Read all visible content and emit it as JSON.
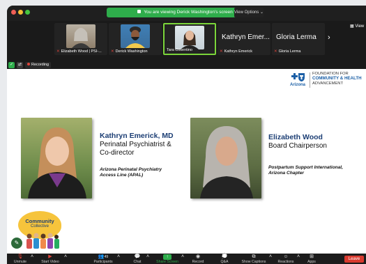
{
  "banner": {
    "text": "You are viewing Derick Washington's screen",
    "view_options": "View Options ⌄"
  },
  "thumbnails": [
    {
      "name": "Elizabeth Wood | PSI-...",
      "has_video": true,
      "active": false
    },
    {
      "name": "Derick Washington",
      "has_video": true,
      "active": false
    },
    {
      "name": "Tara Cosentino",
      "has_video": true,
      "active": true
    },
    {
      "name": "Kathryn Emerick",
      "big_label": "Kathryn Emer...",
      "has_video": false,
      "active": false
    },
    {
      "name": "Gloria Lerma",
      "big_label": "Gloria Lerma",
      "has_video": false,
      "active": false
    }
  ],
  "view_label": "View",
  "status": {
    "recording": "Recording"
  },
  "slide": {
    "logo": {
      "line1": "FOUNDATION FOR",
      "line2": "COMMUNITY & HEALTH",
      "line3": "ADVANCEMENT",
      "region": "Arizona"
    },
    "speakers": [
      {
        "name": "Kathryn Emerick, MD",
        "title_line1": "Perinatal Psychiatrist &",
        "title_line2": "Co-director",
        "org_line1": "Arizona Perinatal Psychiatry",
        "org_line2": "Access Line (APAL)"
      },
      {
        "name": "Elizabeth Wood",
        "title_line1": "Board Chairperson",
        "org_line1": "Postpartum Support International,",
        "org_line2": "Arizona Chapter"
      }
    ],
    "community": {
      "line1": "Community",
      "line2": "Collective"
    }
  },
  "toolbar": {
    "unmute": "Unmute",
    "start_video": "Start Video",
    "participants": "Participants",
    "participants_count": "49",
    "chat": "Chat",
    "share_screen": "Share Screen",
    "record": "Record",
    "qa": "Q&A",
    "show_captions": "Show Captions",
    "reactions": "Reactions",
    "apps": "Apps",
    "leave": "Leave"
  },
  "colors": {
    "accent_green": "#2ead4b",
    "mute_red": "#e0443a",
    "leave_red": "#d93a2f",
    "brand_blue": "#1c3e74"
  }
}
